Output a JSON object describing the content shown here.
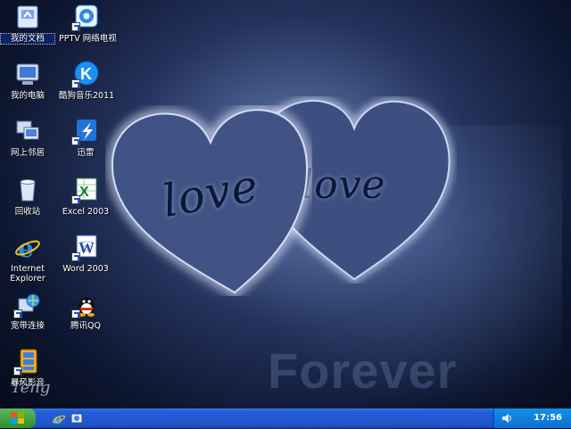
{
  "desktop": {
    "wallpaper_words": {
      "heart_left": "love",
      "heart_right": "love",
      "bottom": "Forever",
      "signature": "Teng"
    },
    "icons": [
      {
        "label": "我的文档",
        "icon": "my-documents-icon"
      },
      {
        "label": "PPTV 网络电视",
        "icon": "pptv-icon"
      },
      {
        "label": "我的电脑",
        "icon": "my-computer-icon"
      },
      {
        "label": "酷狗音乐2011",
        "icon": "kugou-icon"
      },
      {
        "label": "网上邻居",
        "icon": "network-icon"
      },
      {
        "label": "迅雷",
        "icon": "thunder-icon"
      },
      {
        "label": "回收站",
        "icon": "recycle-bin-icon"
      },
      {
        "label": "Excel 2003",
        "icon": "excel-icon"
      },
      {
        "label": "Internet Explorer",
        "icon": "ie-icon"
      },
      {
        "label": "Word 2003",
        "icon": "word-icon"
      },
      {
        "label": "宽带连接",
        "icon": "broadband-icon"
      },
      {
        "label": "腾讯QQ",
        "icon": "qq-icon"
      },
      {
        "label": "暴风影音",
        "icon": "baofeng-icon"
      }
    ]
  },
  "taskbar": {
    "clock": "17:56",
    "colors": {
      "bar": "#245edb",
      "start": "#2f8f2f",
      "tray": "#0e6fd0"
    }
  }
}
